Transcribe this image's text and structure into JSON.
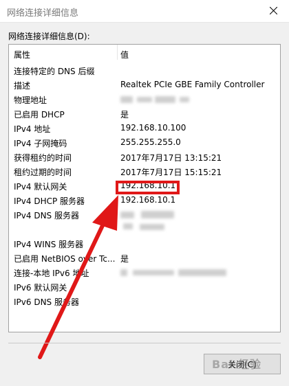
{
  "window": {
    "title": "网络连接详细信息"
  },
  "section_label": "网络连接详细信息(D):",
  "table": {
    "headers": [
      "属性",
      "值"
    ],
    "rows": [
      {
        "property": "连接特定的 DNS 后缀",
        "value": ""
      },
      {
        "property": "描述",
        "value": "Realtek PCIe GBE Family Controller"
      },
      {
        "property": "物理地址",
        "value": ""
      },
      {
        "property": "已启用 DHCP",
        "value": "是"
      },
      {
        "property": "IPv4 地址",
        "value": "192.168.10.100"
      },
      {
        "property": "IPv4 子网掩码",
        "value": "255.255.255.0"
      },
      {
        "property": "获得租约的时间",
        "value": "2017年7月17日 13:15:21"
      },
      {
        "property": "租约过期的时间",
        "value": "2017年7月17日 15:15:21"
      },
      {
        "property": "IPv4 默认网关",
        "value": "192.168.10.1"
      },
      {
        "property": "IPv4 DHCP 服务器",
        "value": "192.168.10.1"
      },
      {
        "property": "IPv4 DNS 服务器",
        "value": ""
      },
      {
        "property": "IPv4 WINS 服务器",
        "value": ""
      },
      {
        "property": "已启用 NetBIOS over Tc...",
        "value": "是"
      },
      {
        "property": "连接-本地 IPv6 地址",
        "value": ""
      },
      {
        "property": "IPv6 默认网关",
        "value": ""
      },
      {
        "property": "IPv6 DNS 服务器",
        "value": ""
      }
    ]
  },
  "buttons": {
    "close": "关闭(C)"
  },
  "watermark": "Bai 经验",
  "colors": {
    "highlight": "#e01818",
    "arrow": "#e01818"
  }
}
